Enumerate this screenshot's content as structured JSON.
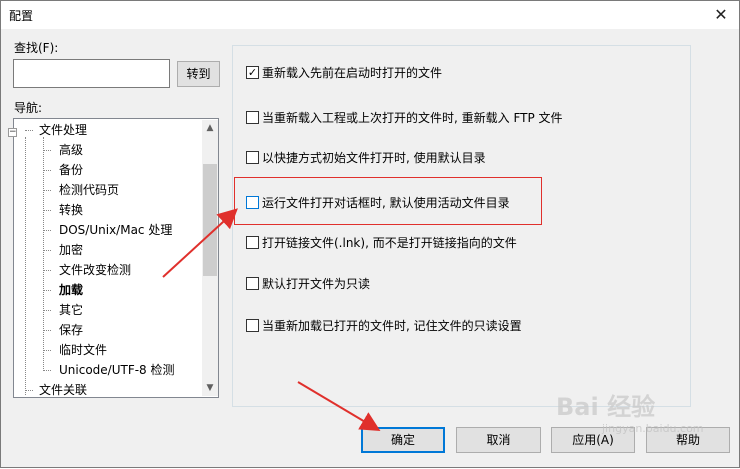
{
  "window": {
    "title": "配置",
    "close_glyph": "✕"
  },
  "find": {
    "label": "查找(F):",
    "value": "",
    "goto_label": "转到"
  },
  "navigation": {
    "label": "导航:",
    "tree": [
      {
        "label": "文件处理",
        "level": 0
      },
      {
        "label": "高级",
        "level": 1
      },
      {
        "label": "备份",
        "level": 1
      },
      {
        "label": "检测代码页",
        "level": 1
      },
      {
        "label": "转换",
        "level": 1
      },
      {
        "label": "DOS/Unix/Mac 处理",
        "level": 1
      },
      {
        "label": "加密",
        "level": 1
      },
      {
        "label": "文件改变检测",
        "level": 1
      },
      {
        "label": "加载",
        "level": 1,
        "selected": true
      },
      {
        "label": "其它",
        "level": 1
      },
      {
        "label": "保存",
        "level": 1
      },
      {
        "label": "临时文件",
        "level": 1
      },
      {
        "label": "Unicode/UTF-8 检测",
        "level": 1
      },
      {
        "label": "文件关联",
        "level": 0
      }
    ],
    "expander_glyph": "−",
    "scroll_up_glyph": "▲",
    "scroll_down_glyph": "▼"
  },
  "options": [
    {
      "label": "重新载入先前在启动时打开的文件",
      "checked": true
    },
    {
      "label": "当重新载入工程或上次打开的文件时, 重新载入 FTP 文件",
      "checked": false
    },
    {
      "label": "以快捷方式初始文件打开时, 使用默认目录",
      "checked": false
    },
    {
      "label": "运行文件打开对话框时, 默认使用活动文件目录",
      "checked": false,
      "highlighted": true
    },
    {
      "label": "打开链接文件(.lnk), 而不是打开链接指向的文件",
      "checked": false
    },
    {
      "label": "默认打开文件为只读",
      "checked": false
    },
    {
      "label": "当重新加载已打开的文件时, 记住文件的只读设置",
      "checked": false
    }
  ],
  "buttons": {
    "ok": "确定",
    "cancel": "取消",
    "apply": "应用(A)",
    "help": "帮助"
  },
  "annotation_color": "#e0302c",
  "watermark": {
    "text": "Bai 经验",
    "sub": "jingyan.baidu.com"
  }
}
